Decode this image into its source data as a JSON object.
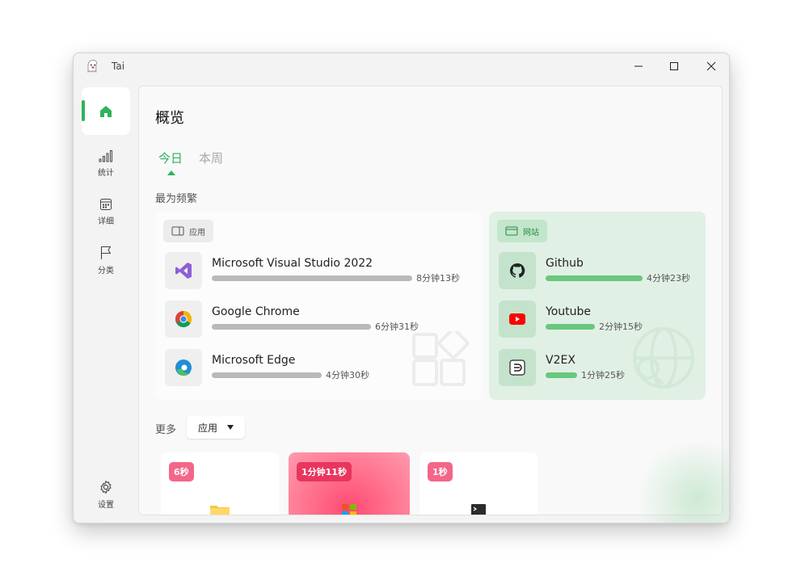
{
  "window": {
    "title": "Tai"
  },
  "sidebar": {
    "items": [
      {
        "label": "",
        "icon": "home-icon",
        "active": true
      },
      {
        "label": "统计",
        "icon": "signal-bars-icon"
      },
      {
        "label": "详细",
        "icon": "calendar-icon"
      },
      {
        "label": "分类",
        "icon": "flag-icon"
      }
    ],
    "settings_label": "设置"
  },
  "page": {
    "title": "概览"
  },
  "tabs": [
    {
      "label": "今日",
      "active": true
    },
    {
      "label": "本周",
      "active": false
    }
  ],
  "frequent": {
    "label": "最为频繁",
    "apps": {
      "chip": "应用",
      "items": [
        {
          "name": "Microsoft Visual Studio 2022",
          "time": "8分钟13秒",
          "fraction": 1.0,
          "icon": "visual-studio-icon"
        },
        {
          "name": "Google Chrome",
          "time": "6分钟31秒",
          "fraction": 0.79,
          "icon": "chrome-icon"
        },
        {
          "name": "Microsoft Edge",
          "time": "4分钟30秒",
          "fraction": 0.55,
          "icon": "edge-icon"
        }
      ]
    },
    "sites": {
      "chip": "网站",
      "items": [
        {
          "name": "Github",
          "time": "4分钟23秒",
          "fraction": 1.0,
          "icon": "github-icon"
        },
        {
          "name": "Youtube",
          "time": "2分钟15秒",
          "fraction": 0.51,
          "icon": "youtube-icon"
        },
        {
          "name": "V2EX",
          "time": "1分钟25秒",
          "fraction": 0.32,
          "icon": "v2ex-icon"
        }
      ]
    }
  },
  "more": {
    "label": "更多",
    "dropdown_value": "应用",
    "tiles": [
      {
        "badge": "6秒",
        "icon": "folder-icon"
      },
      {
        "badge": "1分钟11秒",
        "icon": "windows-store-icon"
      },
      {
        "badge": "1秒",
        "icon": "terminal-icon"
      }
    ]
  },
  "colors": {
    "accent": "#2fb35a",
    "site_bar": "#69c77e",
    "app_bar": "#b9b9b9",
    "badge": "#f3668a"
  }
}
